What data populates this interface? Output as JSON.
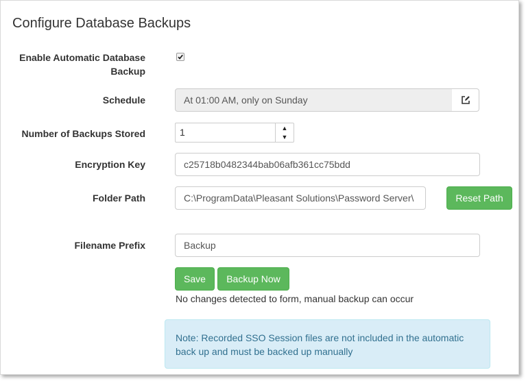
{
  "page": {
    "title": "Configure Database Backups"
  },
  "form": {
    "enable_label_line1": "Enable Automatic Database",
    "enable_label_line2": "Backup",
    "enable_checked": true,
    "schedule_label": "Schedule",
    "schedule_value": "At 01:00 AM, only on Sunday",
    "backups_label": "Number of Backups Stored",
    "backups_value": "1",
    "encryption_label": "Encryption Key",
    "encryption_value": "c25718b0482344bab06afb361cc75bdd",
    "folder_label": "Folder Path",
    "folder_value": "C:\\ProgramData\\Pleasant Solutions\\Password Server\\",
    "reset_path_label": "Reset Path",
    "prefix_label": "Filename Prefix",
    "prefix_value": "Backup",
    "save_label": "Save",
    "backup_now_label": "Backup Now",
    "status_text": "No changes detected to form, manual backup can occur"
  },
  "alert": {
    "text": "Note: Recorded SSO Session files are not included in the automatic back up and must be backed up manually"
  },
  "icons": {
    "schedule_edit": "edit-icon",
    "spin_up": "▲",
    "spin_down": "▼"
  },
  "colors": {
    "success": "#5cb85c",
    "info_bg": "#d9edf7",
    "info_text": "#31708f"
  }
}
